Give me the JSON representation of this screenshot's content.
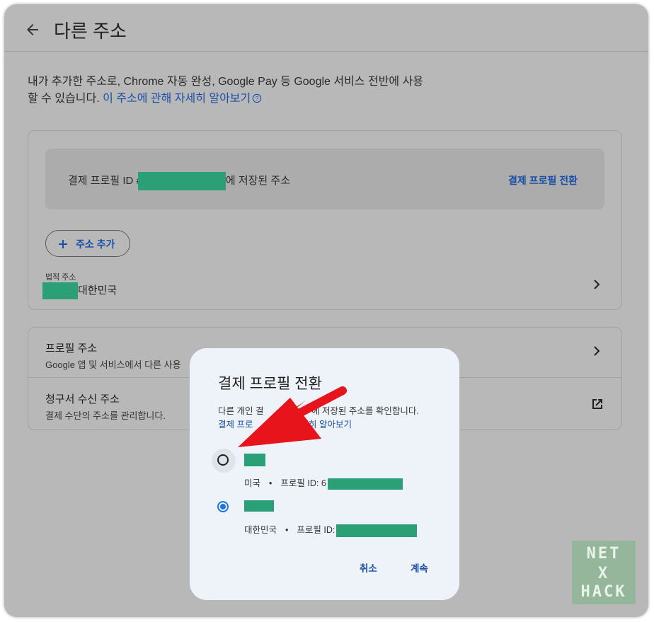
{
  "header": {
    "title": "다른 주소"
  },
  "description": {
    "text": "내가 추가한 주소로, Chrome 자동 완성, Google Pay 등 Google 서비스 전반에 사용할 수 있습니다.",
    "link": "이 주소에 관해 자세히 알아보기"
  },
  "profile_box": {
    "text_prefix": "결제 프로필 ID #",
    "text_suffix": "에 저장된 주소",
    "switch_link": "결제 프로필 전환"
  },
  "add_address_button": "주소 추가",
  "legal_address": {
    "label": "법적 주소",
    "value": "대한민국"
  },
  "rows": [
    {
      "title": "프로필 주소",
      "subtitle": "Google 앱 및 서비스에서 다른 사용"
    },
    {
      "title": "청구서 수신 주소",
      "subtitle": "결제 수단의 주소를 관리합니다."
    }
  ],
  "dialog": {
    "title": "결제 프로필 전환",
    "description_part1": "다른 개인 결",
    "description_part2": "에 저장된 주소를 확인합니다.",
    "link_part1": "결제 프로",
    "link_part2": "자세히 알아보기",
    "options": [
      {
        "country": "미국",
        "profile_id_label": "프로필 ID: 6",
        "selected": false
      },
      {
        "country": "대한민국",
        "profile_id_label": "프로필 ID:",
        "selected": true
      }
    ],
    "cancel": "취소",
    "continue": "계속"
  },
  "watermark": {
    "line1": "NET",
    "line2": "X",
    "line3": "HACK"
  },
  "colors": {
    "link": "#1a4fa8",
    "radio_selected": "#1a73e8",
    "redaction": "#2b9f76",
    "arrow": "#e8141c"
  }
}
